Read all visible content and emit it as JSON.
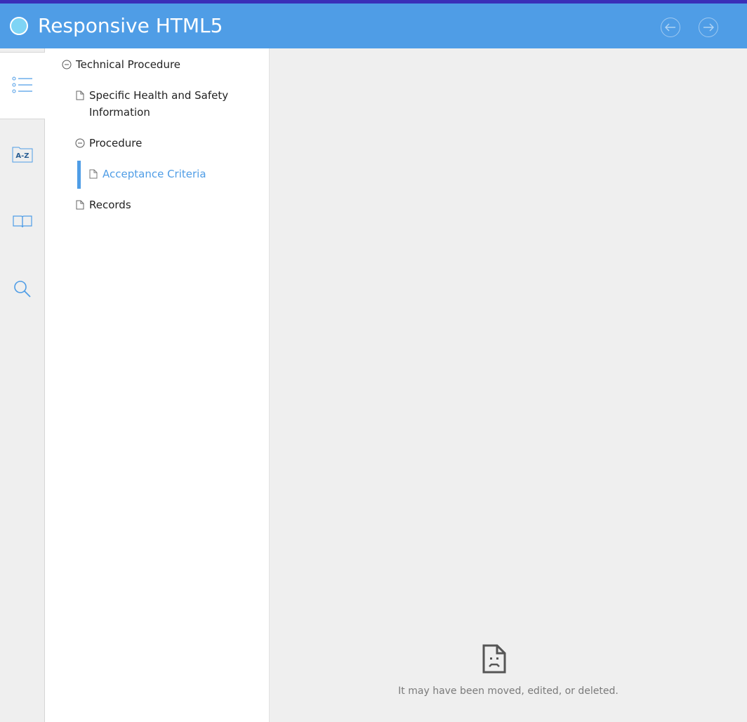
{
  "header": {
    "title": "Responsive HTML5",
    "logo_icon": "circle-logo-icon",
    "back_icon": "arrow-left-icon",
    "forward_icon": "arrow-right-icon",
    "background_color": "#4f9de6",
    "top_strip_color": "#3a2fb8"
  },
  "rail": {
    "tabs": [
      {
        "name": "contents",
        "icon": "list-icon",
        "active": true
      },
      {
        "name": "index",
        "icon": "a-z-icon",
        "label": "A-Z",
        "active": false
      },
      {
        "name": "glossary",
        "icon": "book-icon",
        "active": false
      },
      {
        "name": "search",
        "icon": "search-icon",
        "active": false
      }
    ]
  },
  "toc": {
    "items": [
      {
        "label": "Technical Procedure",
        "icon": "collapse-icon",
        "level": 0
      },
      {
        "label": "Specific Health and Safety Information",
        "icon": "page-icon",
        "level": 1
      },
      {
        "label": "Procedure",
        "icon": "collapse-icon",
        "level": 1
      },
      {
        "label": "Acceptance Criteria",
        "icon": "page-icon",
        "level": 2,
        "selected": true
      },
      {
        "label": "Records",
        "icon": "page-icon",
        "level": 1
      }
    ],
    "accent_color": "#4f9de6"
  },
  "content": {
    "error_icon": "broken-page-icon",
    "error_message": "It may have been moved, edited, or deleted."
  }
}
